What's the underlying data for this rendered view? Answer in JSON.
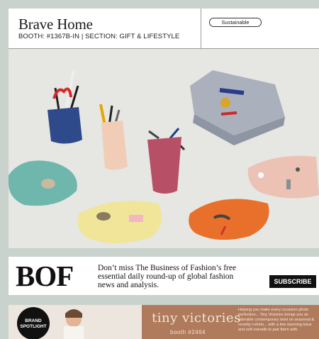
{
  "listing": {
    "brand_name": "Brave Home",
    "booth_line": "BOOTH: #1367B-IN | SECTION: GIFT & LIFESTYLE",
    "tag": "Sustainable",
    "photo_icon": "product-photo"
  },
  "ad": {
    "logo": "BOF",
    "text": "Don’t miss The Business of Fashion’s free essential daily round-up of global fashion news and analysis.",
    "button": "SUBSCRIBE"
  },
  "spotlight": {
    "badge_line1": "BRAND",
    "badge_line2": "SPOTLIGHT",
    "brand": "tiny victories",
    "booth": "booth #2464",
    "blurb": "Helping you make every occasion photo perfection... Tiny Victories brings you an adorable contemporary twist on seasonal & novelty t-shirts... with a few stunning tutus and soft overalls to pair them with."
  },
  "colors": {
    "background": "#c9d2cc",
    "photo_bg": "#e6e6e3",
    "spotlight_brown": "#b07a5c"
  }
}
